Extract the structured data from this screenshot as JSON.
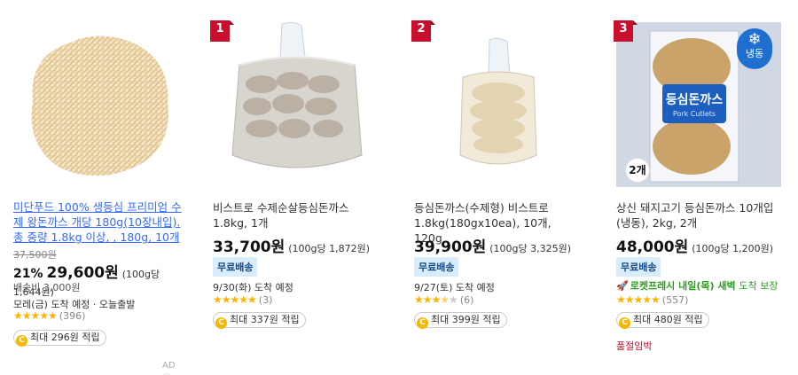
{
  "products": [
    {
      "title": "미단푸드 100% 생등심 프리미엄 수제 왕돈까스 개당 180g(10장내입).총 중량 1.8kg 이상, , 180g, 10개",
      "original_price": "37,500원",
      "discount": "21%",
      "price": "29,600원",
      "unit_price": "(100g당 1,644원)",
      "shipping_fee": "배송비 3,000원",
      "delivery": "모레(금) 도착 예정 · 오늘출발",
      "rating_stars": 5,
      "review_count": "(396)",
      "cashback_coin": "C",
      "cashback": "최대 296원 적립",
      "ad_label": "AD ⓘ"
    },
    {
      "rank": "1",
      "title": "비스트로 수제순살등심돈까스 1.8kg, 1개",
      "price": "33,700원",
      "unit_price": "(100g당 1,872원)",
      "free_shipping": "무료배송",
      "delivery": "9/30(화) 도착 예정",
      "rating_stars": 5,
      "review_count": "(3)",
      "cashback_coin": "C",
      "cashback": "최대 337원 적립"
    },
    {
      "rank": "2",
      "title": "등심돈까스(수제형) 비스트로 1.8kg(180gx10ea), 10개, 120g",
      "price": "39,900원",
      "unit_price": "(100g당 3,325원)",
      "free_shipping": "무료배송",
      "delivery": "9/27(토) 도착 예정",
      "rating_stars": 3.5,
      "review_count": "(6)",
      "cashback_coin": "C",
      "cashback": "최대 399원 적립"
    },
    {
      "rank": "3",
      "quantity_badge": "2개",
      "frozen_label": "냉동",
      "title": "상신 돼지고기 등심돈까스 10개입 (냉동), 2kg, 2개",
      "price": "48,000원",
      "unit_price": "(100g당 1,200원)",
      "free_shipping": "무료배송",
      "rocket_brand": "로켓프레시",
      "rocket_text": "내일(목) 새벽",
      "rocket_suffix": "도착 보장",
      "rating_stars": 5,
      "review_count": "(557)",
      "cashback_coin": "C",
      "cashback": "최대 480원 적립",
      "soldout": "품절임박",
      "package_text": "등심돈까스",
      "package_subtext": "Pork Cutlets"
    }
  ],
  "colors": {
    "rank_badge": "#c8102e",
    "link": "#346aff",
    "star": "#ffb400",
    "free_ship_bg": "#d8ecfa",
    "rocket_green": "#2aa01f",
    "frozen_badge": "#1e6fd0"
  }
}
